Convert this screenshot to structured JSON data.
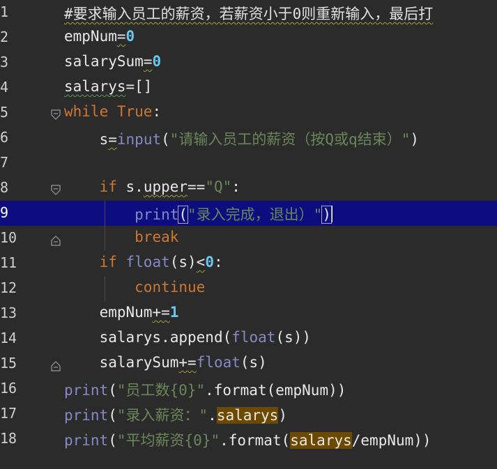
{
  "editor": {
    "lines": [
      {
        "n": "1",
        "segs": [
          {
            "t": "#要求输入员工的薪资，若薪资小于0则重新输入，最后打",
            "c": "cmt wavy"
          }
        ]
      },
      {
        "n": "2",
        "segs": [
          {
            "t": "empNum",
            "c": ""
          },
          {
            "t": "=",
            "c": "wavy"
          },
          {
            "t": "0",
            "c": "num"
          }
        ]
      },
      {
        "n": "3",
        "segs": [
          {
            "t": "salarySum",
            "c": ""
          },
          {
            "t": "=",
            "c": "wavy"
          },
          {
            "t": "0",
            "c": "num"
          }
        ]
      },
      {
        "n": "4",
        "segs": [
          {
            "t": "salarys",
            "c": "wavy-blue"
          },
          {
            "t": "=[]",
            "c": ""
          }
        ]
      },
      {
        "n": "5",
        "segs": [
          {
            "t": "while ",
            "c": "kw"
          },
          {
            "t": "True",
            "c": "kw"
          },
          {
            "t": ":",
            "c": ""
          }
        ]
      },
      {
        "n": "6",
        "segs": [
          {
            "t": "    ",
            "c": ""
          },
          {
            "t": "s",
            "c": ""
          },
          {
            "t": "=",
            "c": "wavy"
          },
          {
            "t": "input",
            "c": "bi"
          },
          {
            "t": "(",
            "c": ""
          },
          {
            "t": "\"请输入员工的薪资（按Q或q结束）\"",
            "c": "str"
          },
          {
            "t": ")",
            "c": ""
          }
        ]
      },
      {
        "n": "7",
        "segs": []
      },
      {
        "n": "8",
        "segs": [
          {
            "t": "    ",
            "c": ""
          },
          {
            "t": "if ",
            "c": "kw"
          },
          {
            "t": "s.",
            "c": ""
          },
          {
            "t": "upper",
            "c": "wavy"
          },
          {
            "t": "==",
            "c": ""
          },
          {
            "t": "\"Q\"",
            "c": "str"
          },
          {
            "t": ":",
            "c": ""
          }
        ]
      },
      {
        "n": "9",
        "segs": [
          {
            "t": "        ",
            "c": ""
          },
          {
            "t": "print",
            "c": "bi"
          },
          {
            "t": "(",
            "c": "bracket"
          },
          {
            "t": "\"录入完成，退出）\"",
            "c": "str"
          },
          {
            "t": ")",
            "c": "bracket"
          }
        ],
        "current": true
      },
      {
        "n": "10",
        "segs": [
          {
            "t": "        ",
            "c": ""
          },
          {
            "t": "break",
            "c": "kw"
          }
        ]
      },
      {
        "n": "11",
        "segs": [
          {
            "t": "    ",
            "c": ""
          },
          {
            "t": "if ",
            "c": "kw"
          },
          {
            "t": "float",
            "c": "bi"
          },
          {
            "t": "(s)",
            "c": ""
          },
          {
            "t": "<",
            "c": "wavy"
          },
          {
            "t": "0",
            "c": "num"
          },
          {
            "t": ":",
            "c": ""
          }
        ]
      },
      {
        "n": "12",
        "segs": [
          {
            "t": "        ",
            "c": ""
          },
          {
            "t": "continue",
            "c": "kw"
          }
        ]
      },
      {
        "n": "13",
        "segs": [
          {
            "t": "    ",
            "c": ""
          },
          {
            "t": "empNum",
            "c": ""
          },
          {
            "t": "+=",
            "c": "wavy"
          },
          {
            "t": "1",
            "c": "num"
          }
        ]
      },
      {
        "n": "14",
        "segs": [
          {
            "t": "    ",
            "c": ""
          },
          {
            "t": "salarys.append(",
            "c": ""
          },
          {
            "t": "float",
            "c": "bi"
          },
          {
            "t": "(s))",
            "c": ""
          }
        ]
      },
      {
        "n": "15",
        "segs": [
          {
            "t": "    ",
            "c": ""
          },
          {
            "t": "salarySum",
            "c": ""
          },
          {
            "t": "+=",
            "c": "wavy"
          },
          {
            "t": "float",
            "c": "bi"
          },
          {
            "t": "(s)",
            "c": ""
          }
        ]
      },
      {
        "n": "16",
        "segs": [
          {
            "t": "print",
            "c": "bi"
          },
          {
            "t": "(",
            "c": ""
          },
          {
            "t": "\"员工数{0}\"",
            "c": "str"
          },
          {
            "t": ".format(empNum))",
            "c": ""
          }
        ]
      },
      {
        "n": "17",
        "segs": [
          {
            "t": "print",
            "c": "bi"
          },
          {
            "t": "(",
            "c": ""
          },
          {
            "t": "\"录入薪资：\"",
            "c": "str"
          },
          {
            "t": ".",
            "c": ""
          },
          {
            "t": "salarys",
            "c": "hl"
          },
          {
            "t": ")",
            "c": ""
          }
        ]
      },
      {
        "n": "18",
        "segs": [
          {
            "t": "print",
            "c": "bi"
          },
          {
            "t": "(",
            "c": ""
          },
          {
            "t": "\"平均薪资{0}\"",
            "c": "str"
          },
          {
            "t": ".format(",
            "c": ""
          },
          {
            "t": "salarys",
            "c": "hl"
          },
          {
            "t": "/empNum))",
            "c": ""
          }
        ]
      }
    ],
    "fold_marks": [
      5,
      8,
      10,
      15
    ],
    "colors": {
      "background": "#2b2b2b",
      "current_line": "#0d0d80",
      "keyword": "#cc7832",
      "builtin": "#8888c6",
      "string": "#6a8759",
      "number": "#68c7f0"
    }
  }
}
